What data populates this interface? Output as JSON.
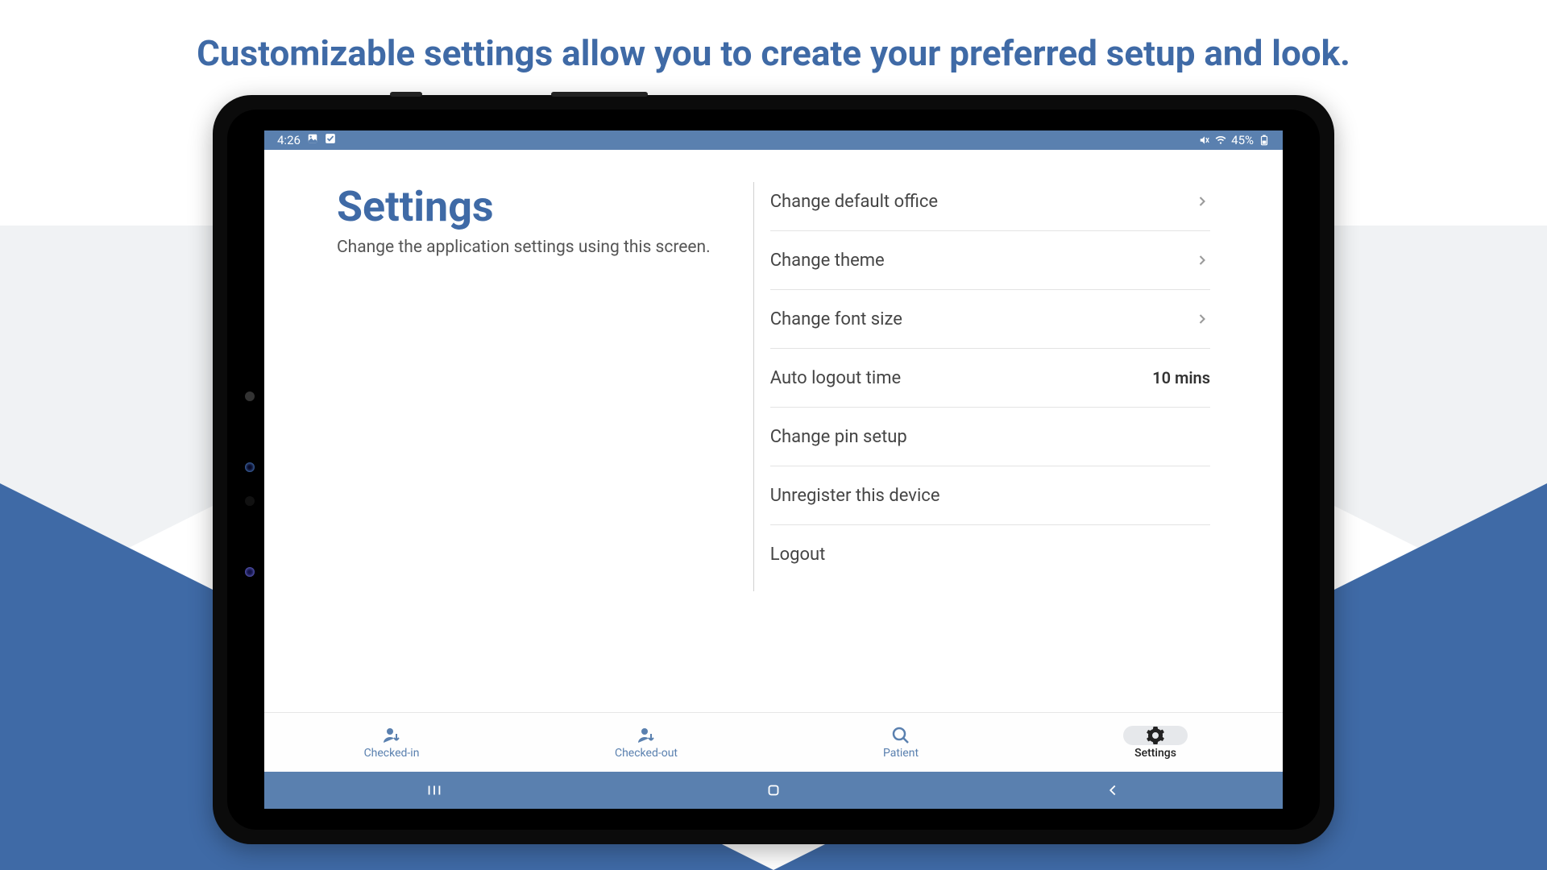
{
  "headline": "Customizable settings allow you to create your preferred setup and look.",
  "status": {
    "time": "4:26",
    "battery_pct": "45%"
  },
  "page": {
    "title": "Settings",
    "subtitle": "Change the application settings using this screen."
  },
  "settings": {
    "items": [
      {
        "label": "Change default office",
        "has_chevron": true
      },
      {
        "label": "Change theme",
        "has_chevron": true
      },
      {
        "label": "Change font size",
        "has_chevron": true
      },
      {
        "label": "Auto logout time",
        "value": "10 mins"
      },
      {
        "label": "Change pin setup"
      },
      {
        "label": "Unregister this device"
      },
      {
        "label": "Logout"
      }
    ]
  },
  "tabs": {
    "items": [
      {
        "label": "Checked-in",
        "icon": "user-down",
        "active": false
      },
      {
        "label": "Checked-out",
        "icon": "user-down",
        "active": false
      },
      {
        "label": "Patient",
        "icon": "search",
        "active": false
      },
      {
        "label": "Settings",
        "icon": "gear",
        "active": true
      }
    ]
  }
}
